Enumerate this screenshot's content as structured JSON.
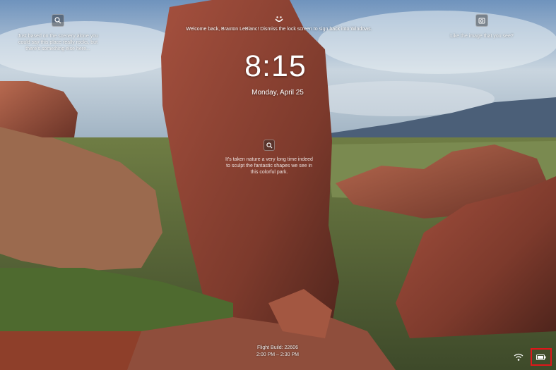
{
  "spotlight": {
    "left_tip": "Just based on the scenery alone you could say this place really rocks, but there's something else here...",
    "right_tip": "Like the image that you see?",
    "center_tip": "It's taken nature a very long time indeed to sculpt the fantastic shapes we see in this colorful park."
  },
  "welcome": {
    "message": "Welcome back, Braxton LeBlanc! Dismiss the lock screen to sign back into Windows."
  },
  "clock": {
    "time": "8:15",
    "date": "Monday, April 25"
  },
  "build": {
    "line1": "Flight Build: 22606",
    "line2": "2:00 PM – 2:30 PM"
  },
  "icons": {
    "left_tip": "search-icon",
    "right_tip": "camera-icon",
    "center_tip": "search-icon",
    "welcome": "smiley-icon",
    "network": "wifi-icon",
    "battery": "battery-icon"
  },
  "colors": {
    "highlight_box": "#e0161a"
  }
}
